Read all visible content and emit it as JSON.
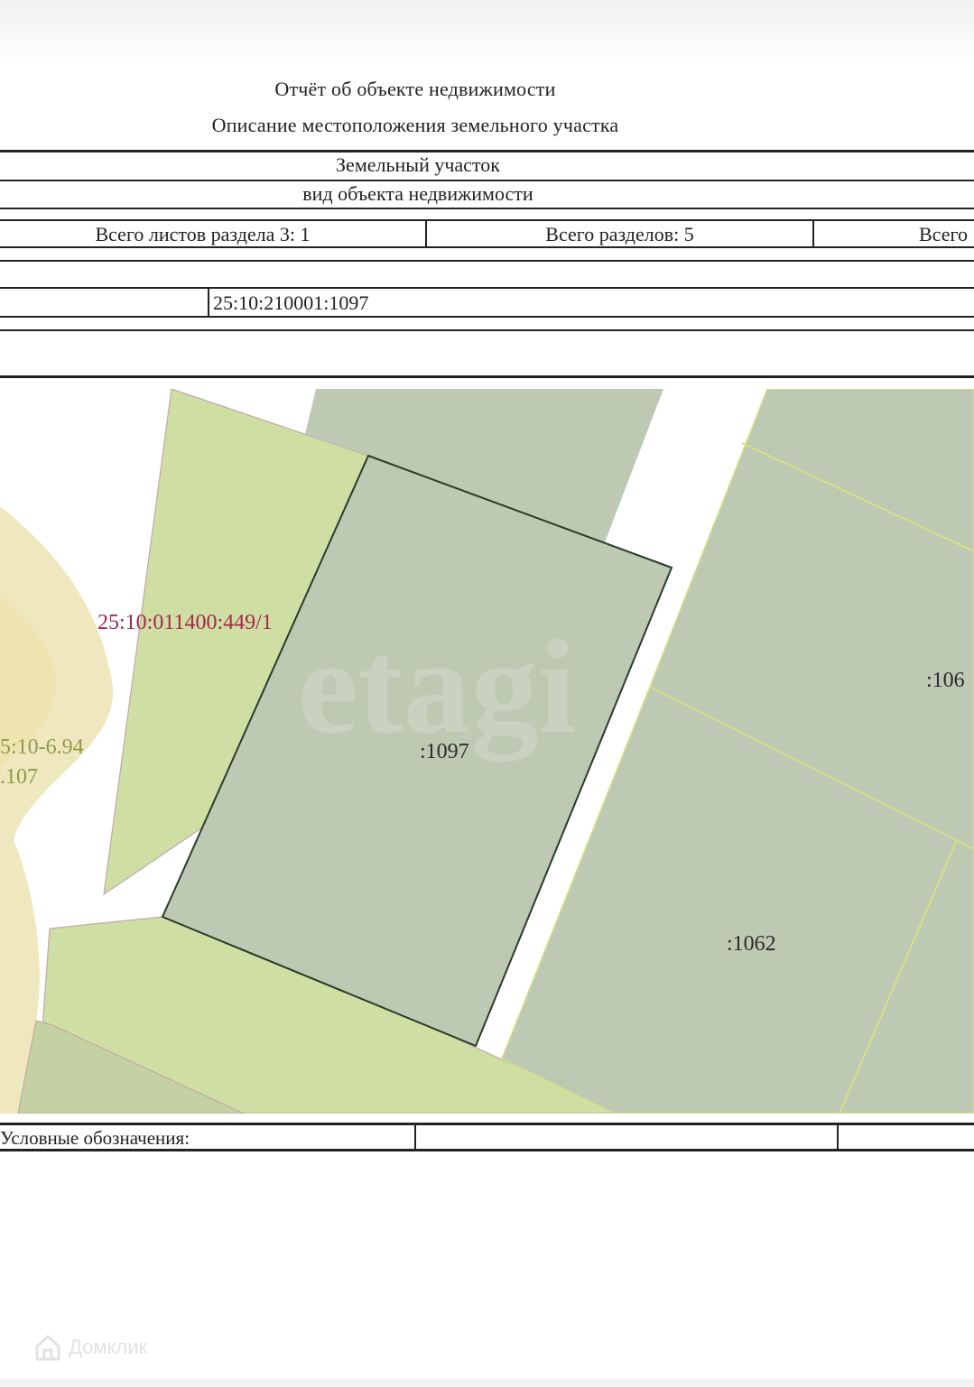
{
  "document": {
    "title": "Отчёт об объекте недвижимости",
    "subtitle": "Описание местоположения земельного участка"
  },
  "header_table": {
    "object_type": "Земельный участок",
    "object_type_caption": "вид объекта недвижимости",
    "sheets_in_section": "Всего листов раздела 3: 1",
    "total_sections": "Всего разделов: 5",
    "total_sheets_cut": "Всего",
    "cadastral_number": "25:10:210001:1097"
  },
  "map": {
    "labels": {
      "parcel_main": ":1097",
      "parcel_1062": ":1062",
      "parcel_right_cut": ":106",
      "neighbor_parcel": "25:10:011400:449/1",
      "zone_line1": "5:10-6.94",
      "zone_line2": ".107"
    },
    "colors": {
      "parcel_gray": "#bdc9b3",
      "parcel_light_green": "#cfdfa4",
      "zone_yellow": "#efe8bf",
      "zone_inner": "#ece3a8",
      "neighbor_label": "#a2294a",
      "zone_label": "#8e9a4a"
    }
  },
  "legend": {
    "label": "Условные обозначения:"
  },
  "watermark": {
    "brand": "Домклик",
    "map_watermark": "etagi"
  }
}
